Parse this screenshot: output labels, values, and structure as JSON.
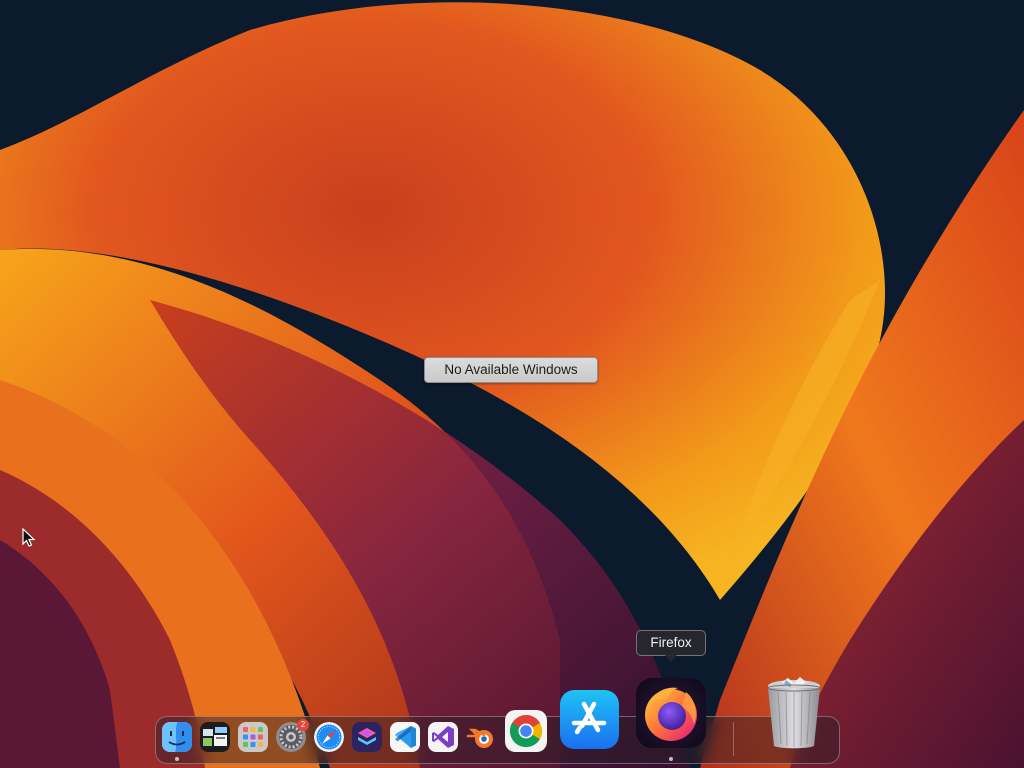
{
  "desktop": {
    "message": "No Available Windows"
  },
  "dock": {
    "tooltip": "Firefox",
    "items": [
      {
        "name": "Finder",
        "icon": "finder-icon",
        "running": true
      },
      {
        "name": "Mission Control",
        "icon": "mission-control-icon",
        "running": false
      },
      {
        "name": "Launchpad",
        "icon": "launchpad-icon",
        "running": false
      },
      {
        "name": "System Settings",
        "icon": "settings-gear-icon",
        "running": false,
        "badge": "2"
      },
      {
        "name": "Safari",
        "icon": "safari-compass-icon",
        "running": false
      },
      {
        "name": "Shortcuts",
        "icon": "shortcuts-icon",
        "running": false
      },
      {
        "name": "Visual Studio Code",
        "icon": "vscode-icon",
        "running": false
      },
      {
        "name": "Visual Studio",
        "icon": "visual-studio-icon",
        "running": false
      },
      {
        "name": "Blender",
        "icon": "blender-icon",
        "running": false
      },
      {
        "name": "Google Chrome",
        "icon": "chrome-icon",
        "running": false
      },
      {
        "name": "App Store",
        "icon": "app-store-icon",
        "running": false
      },
      {
        "name": "Firefox",
        "icon": "firefox-icon",
        "running": true
      },
      {
        "name": "Trash",
        "icon": "trash-icon",
        "running": false
      }
    ]
  },
  "colors": {
    "background": "#0c1a2e",
    "wallpaper_orange": "#f08a1c",
    "wallpaper_red": "#c2321d",
    "wallpaper_magenta": "#7a1f45"
  }
}
